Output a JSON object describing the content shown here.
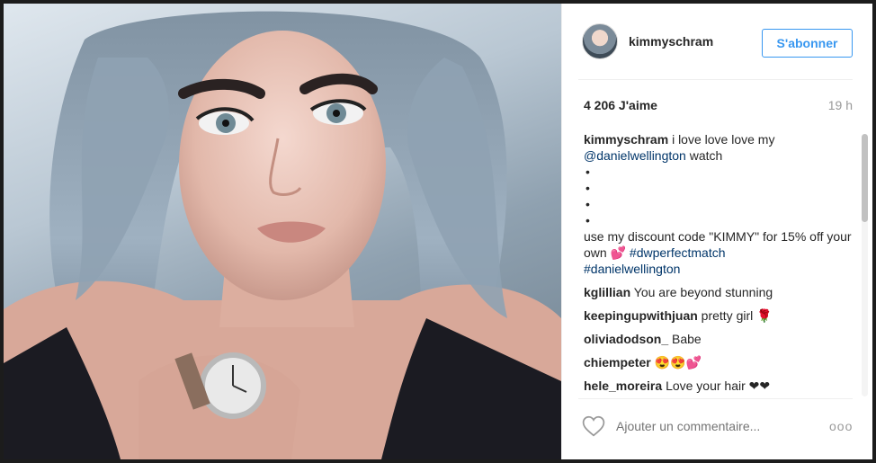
{
  "post": {
    "photo_alt": "kimmyschram",
    "author": "kimmyschram",
    "follow_label": "S'abonner",
    "likes": "4 206 J'aime",
    "time": "19 h"
  },
  "caption": {
    "user": "kimmyschram",
    "text_1": "i love love love my",
    "mention": "@danielwellington",
    "text_2": "watch",
    "bullets": [
      "•",
      "•",
      "•",
      "•"
    ],
    "text_3": "use my discount code \"KIMMY\" for 15% off your own 💕",
    "hashtag_1": "#dwperfectmatch",
    "hashtag_2": "#danielwellington"
  },
  "comments": [
    {
      "user": "kglillian",
      "text": "You are beyond stunning"
    },
    {
      "user": "keepingupwithjuan",
      "text": "pretty girl 🌹"
    },
    {
      "user": "oliviadodson_",
      "text": "Babe"
    },
    {
      "user": "chiempeter",
      "text": "😍😍💕"
    },
    {
      "user": "hele_moreira",
      "text": "Love your hair ❤❤"
    }
  ],
  "footer": {
    "comment_placeholder": "Ajouter un commentaire...",
    "more_label": "ooo"
  },
  "colors": {
    "accent": "#3897f0",
    "link": "#003569",
    "muted": "#999999"
  }
}
